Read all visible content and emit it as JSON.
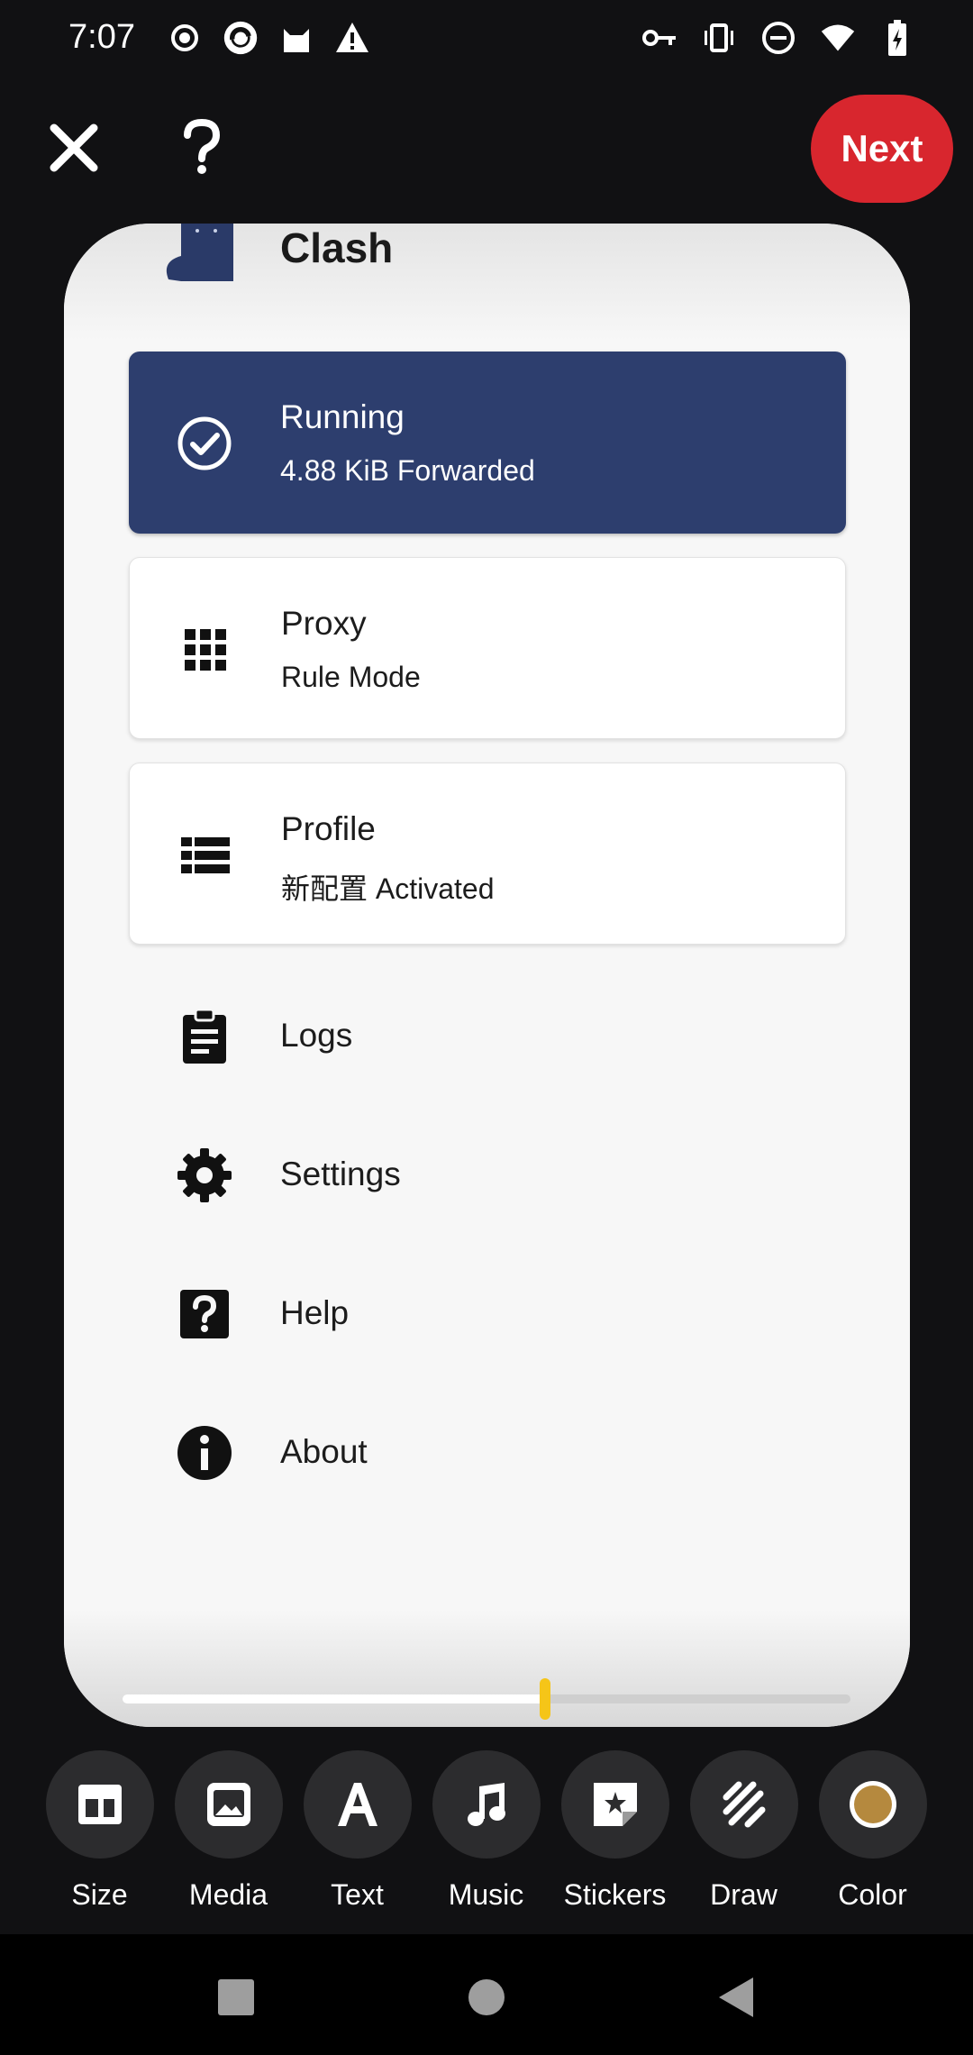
{
  "status_bar": {
    "time": "7:07",
    "left_icons": [
      "record-icon",
      "app-notification-icon",
      "cat-icon",
      "warning-icon"
    ],
    "right_icons": [
      "vpn-key-icon",
      "vibrate-icon",
      "do-not-disturb-icon",
      "wifi-icon",
      "battery-charging-icon"
    ]
  },
  "top_bar": {
    "next_label": "Next"
  },
  "app": {
    "title": "Clash",
    "running": {
      "title": "Running",
      "subtitle": "4.88 KiB Forwarded"
    },
    "proxy": {
      "title": "Proxy",
      "subtitle": "Rule Mode"
    },
    "profile": {
      "title": "Profile",
      "subtitle": "新配置 Activated"
    },
    "menu": [
      {
        "label": "Logs",
        "icon": "clipboard-icon"
      },
      {
        "label": "Settings",
        "icon": "gear-icon"
      },
      {
        "label": "Help",
        "icon": "help-icon"
      },
      {
        "label": "About",
        "icon": "info-icon"
      }
    ],
    "colors": {
      "running_card": "#2d3e6e",
      "card_bg": "#f7f7f7"
    }
  },
  "timeline": {
    "progress": 0.58,
    "handle_color": "#f5c518"
  },
  "toolbar": {
    "items": [
      {
        "label": "Size",
        "icon": "size-icon"
      },
      {
        "label": "Media",
        "icon": "media-icon"
      },
      {
        "label": "Text",
        "icon": "text-icon"
      },
      {
        "label": "Music",
        "icon": "music-icon"
      },
      {
        "label": "Stickers",
        "icon": "stickers-icon"
      },
      {
        "label": "Draw",
        "icon": "draw-icon"
      },
      {
        "label": "Color",
        "icon": "color-icon"
      }
    ]
  },
  "colors": {
    "next_button": "#d8262e",
    "background": "#111113"
  }
}
